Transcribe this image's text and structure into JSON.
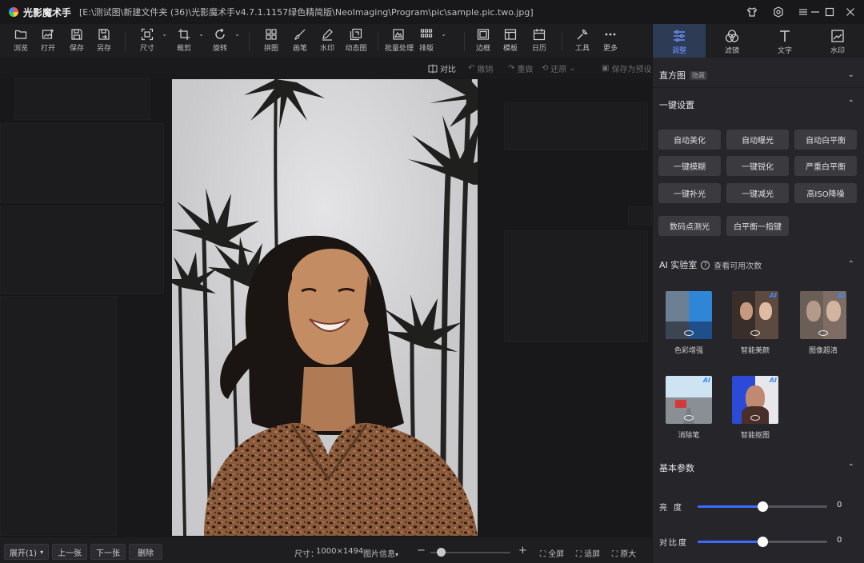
{
  "titlebar": {
    "app_name": "光影魔术手",
    "file_path": "[E:\\测试图\\新建文件夹 (36)\\光影魔术手v4.7.1.1157绿色精简版\\NeoImaging\\Program\\pic\\sample.pic.two.jpg]"
  },
  "toolbar": {
    "items": [
      {
        "label": "浏览",
        "icon": "folder-icon"
      },
      {
        "label": "打开",
        "icon": "open-image-icon"
      },
      {
        "label": "保存",
        "icon": "save-icon"
      },
      {
        "label": "另存",
        "icon": "save-as-icon"
      },
      {
        "label": "尺寸",
        "icon": "resize-icon"
      },
      {
        "label": "裁剪",
        "icon": "crop-icon"
      },
      {
        "label": "旋转",
        "icon": "rotate-icon"
      },
      {
        "label": "拼图",
        "icon": "collage-icon"
      },
      {
        "label": "画笔",
        "icon": "brush-icon"
      },
      {
        "label": "水印",
        "icon": "watermark-icon"
      },
      {
        "label": "动态图",
        "icon": "gif-icon"
      },
      {
        "label": "批量处理",
        "icon": "batch-icon"
      },
      {
        "label": "排版",
        "icon": "layout-icon"
      },
      {
        "label": "边框",
        "icon": "frame-icon"
      },
      {
        "label": "模板",
        "icon": "template-icon"
      },
      {
        "label": "日历",
        "icon": "calendar-icon"
      },
      {
        "label": "工具",
        "icon": "tools-icon"
      },
      {
        "label": "更多",
        "icon": "more-icon"
      }
    ]
  },
  "subbar": {
    "compare": "对比",
    "undo": "撤销",
    "redo": "重做",
    "restore": "还原",
    "save_as_preset": "保存为预设"
  },
  "bottombar": {
    "view_mode": "展开(1)",
    "prev": "上一张",
    "next": "下一张",
    "delete": "删除",
    "size_label": "尺寸：",
    "size_value": "1000×1494",
    "image_info": "图片信息",
    "fullscreen": "全屏",
    "fit": "适屏",
    "original": "原大",
    "zoom_fraction": 0.13
  },
  "panel": {
    "tabs": [
      {
        "label": "调整",
        "icon": "sliders-icon",
        "active": true
      },
      {
        "label": "滤镜",
        "icon": "filter-icon",
        "active": false
      },
      {
        "label": "文字",
        "icon": "text-icon",
        "active": false
      },
      {
        "label": "水印",
        "icon": "watermark-tab-icon",
        "active": false
      }
    ],
    "histogram": {
      "title": "直方图",
      "badge": "隐藏"
    },
    "quick_settings": {
      "title": "一键设置",
      "buttons": [
        "自动美化",
        "自动曝光",
        "自动白平衡",
        "一键模糊",
        "一键锐化",
        "严重白平衡",
        "一键补光",
        "一键减光",
        "高ISO降噪",
        "数码点测光",
        "白平衡一指键"
      ]
    },
    "ai_lab": {
      "title": "AI 实验室",
      "remaining": "查看可用次数",
      "items": [
        {
          "label": "色彩增强"
        },
        {
          "label": "智能美颜"
        },
        {
          "label": "图像超清"
        },
        {
          "label": "消除笔"
        },
        {
          "label": "智能抠图"
        }
      ]
    },
    "basic_params": {
      "title": "基本参数",
      "sliders": [
        {
          "label": "亮度",
          "value": "0",
          "level": 0.5
        },
        {
          "label": "对比度",
          "value": "0",
          "level": 0.5
        }
      ]
    }
  },
  "colors": {
    "accent": "#3b6cff",
    "panel_bg": "#26262a",
    "toolbar_bg": "#1e1e21"
  }
}
